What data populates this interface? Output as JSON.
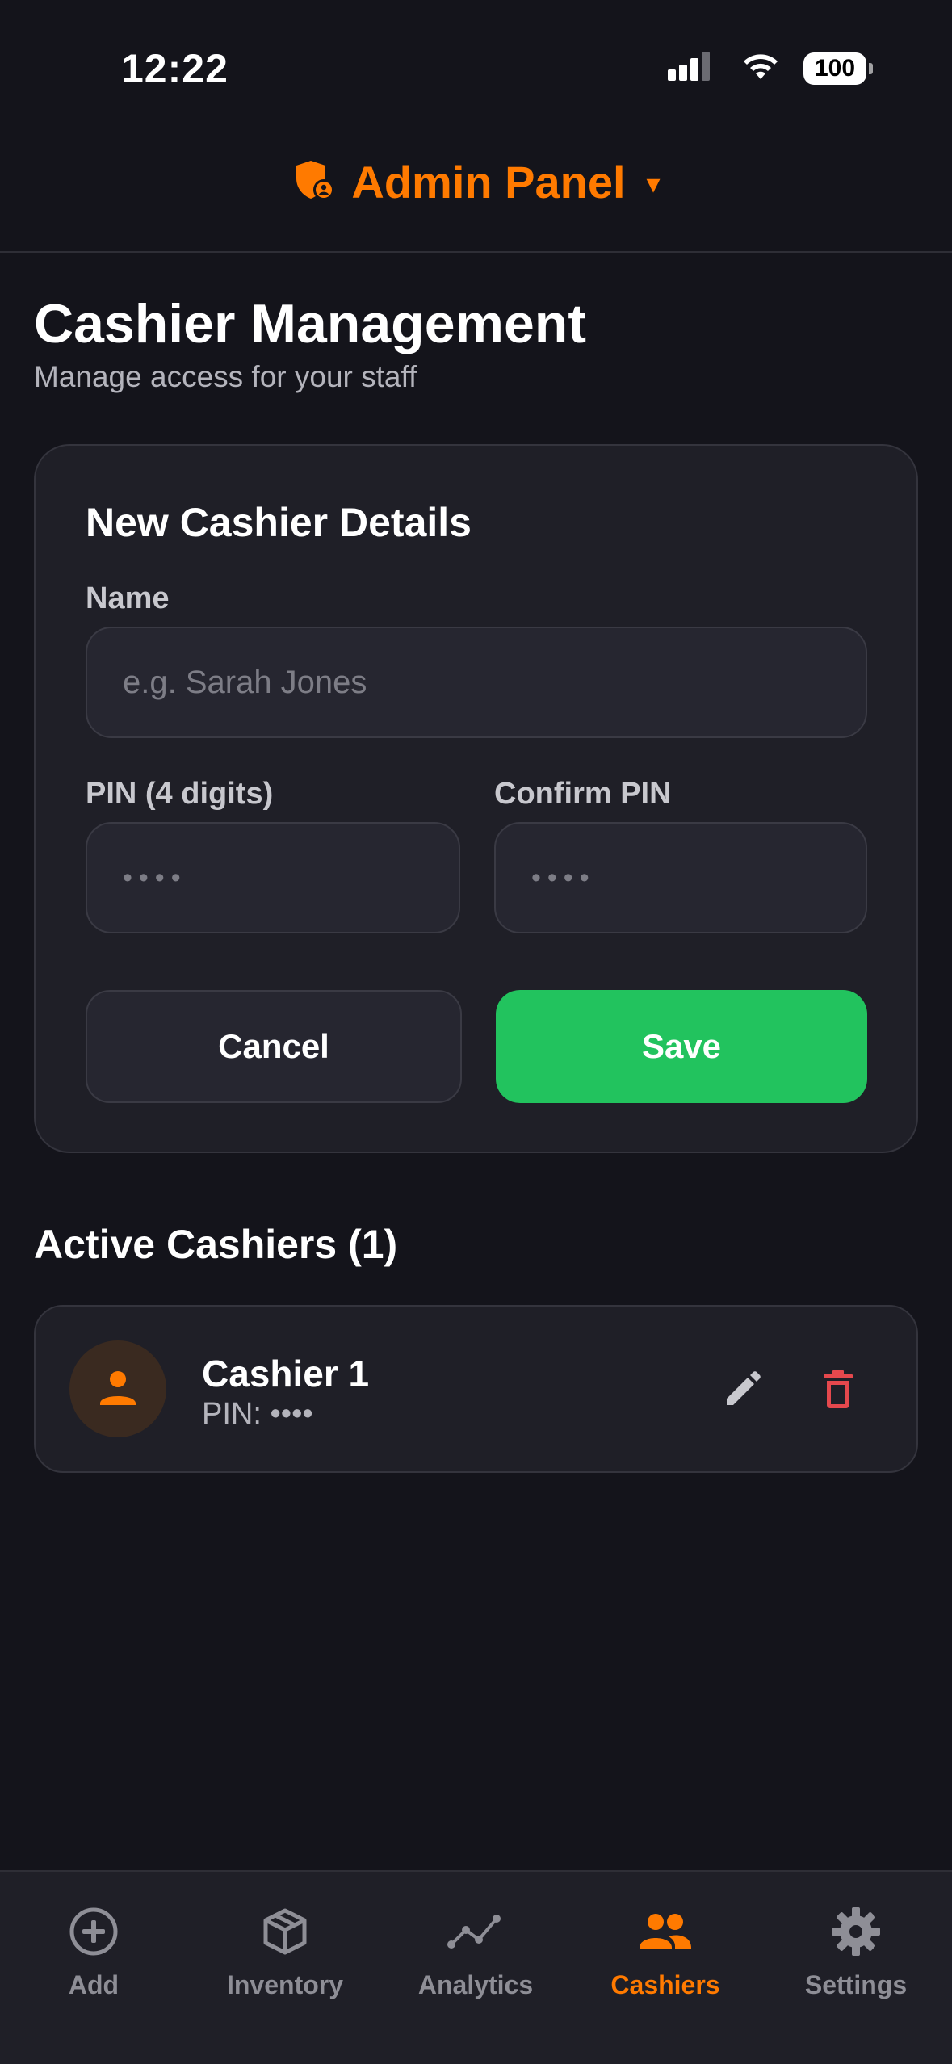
{
  "status_bar": {
    "time": "12:22",
    "battery": "100"
  },
  "header": {
    "title": "Admin Panel",
    "caret": "▾"
  },
  "page": {
    "title": "Cashier Management",
    "subtitle": "Manage access for your staff"
  },
  "form": {
    "title": "New Cashier Details",
    "name_label": "Name",
    "name_placeholder": "e.g. Sarah Jones",
    "pin_label": "PIN (4 digits)",
    "pin_placeholder": "••••",
    "confirm_label": "Confirm PIN",
    "confirm_placeholder": "••••",
    "cancel_label": "Cancel",
    "save_label": "Save"
  },
  "active": {
    "title": "Active Cashiers (1)",
    "cashiers": [
      {
        "name": "Cashier 1",
        "pin": "PIN: ••••"
      }
    ]
  },
  "nav": {
    "items": [
      {
        "label": "Add",
        "icon": "plus-circle-icon",
        "active": false
      },
      {
        "label": "Inventory",
        "icon": "box-icon",
        "active": false
      },
      {
        "label": "Analytics",
        "icon": "chart-line-icon",
        "active": false
      },
      {
        "label": "Cashiers",
        "icon": "people-icon",
        "active": true
      },
      {
        "label": "Settings",
        "icon": "gear-icon",
        "active": false
      }
    ]
  },
  "colors": {
    "accent": "#ff7a00",
    "save": "#22c35e",
    "delete": "#e5484d",
    "background": "#14141b",
    "card": "#1f1f27"
  }
}
